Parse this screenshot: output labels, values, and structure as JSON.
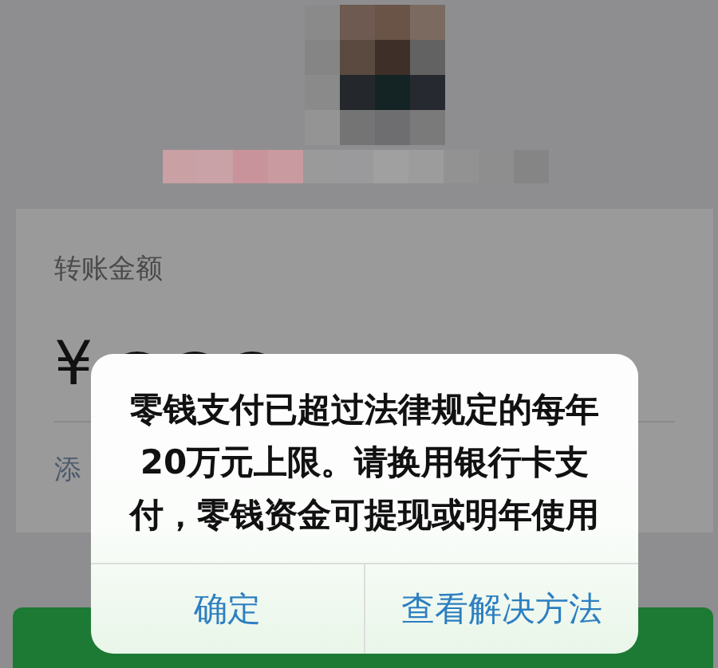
{
  "amount_card": {
    "label": "转账金额",
    "currency": "¥",
    "note_link": "添"
  },
  "dialog": {
    "message": "零钱支付已超过法律规定的每年20万元上限。请换用银行卡支付，零钱资金可提现或明年使用",
    "buttons": [
      {
        "label": "确定"
      },
      {
        "label": "查看解决方法"
      }
    ]
  }
}
